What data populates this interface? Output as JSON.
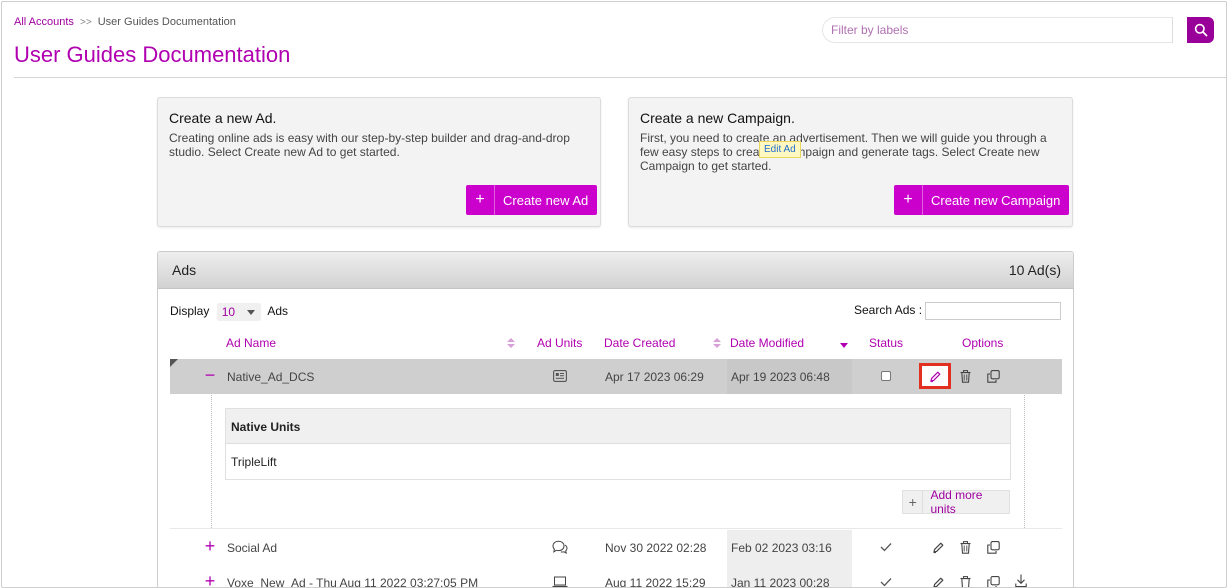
{
  "header": {
    "breadcrumb_root": "All Accounts",
    "breadcrumb_sep": ">>",
    "breadcrumb_current": "User Guides Documentation",
    "title": "User Guides Documentation",
    "filter_placeholder": "Filter by labels"
  },
  "cards": {
    "ad": {
      "title": "Create a new Ad.",
      "desc": "Creating online ads is easy with our step-by-step builder and drag-and-drop studio. Select Create new Ad to get started.",
      "button": "Create new Ad"
    },
    "campaign": {
      "title": "Create a new Campaign.",
      "desc": "First, you need to create an advertisement. Then we will guide you through a few easy steps to create a campaign and generate tags. Select Create new Campaign to get started.",
      "button": "Create new Campaign"
    },
    "plus": "+"
  },
  "ads": {
    "title": "Ads",
    "count": "10 Ad(s)",
    "display_label": "Display",
    "display_value": "10",
    "display_suffix": "Ads",
    "search_label": "Search Ads :",
    "columns": {
      "name": "Ad Name",
      "units": "Ad Units",
      "created": "Date Created",
      "modified": "Date Modified",
      "status": "Status",
      "options": "Options"
    },
    "rows": [
      {
        "expander": "−",
        "name": "Native_Ad_DCS",
        "created": "Apr 17 2023 06:29",
        "modified": "Apr 19 2023 06:48"
      },
      {
        "expander": "+",
        "name": "Social Ad",
        "created": "Nov 30 2022 02:28",
        "modified": "Feb 02 2023 03:16"
      },
      {
        "expander": "+",
        "name": "Voxe_New_Ad - Thu Aug 11 2022 03:27:05 PM",
        "created": "Aug 11 2022 15:29",
        "modified": "Jan 11 2023 00:28"
      }
    ],
    "tooltip": "Edit Ad",
    "detail": {
      "header": "Native Units",
      "unit": "TripleLift",
      "add_more": "Add more units"
    }
  },
  "colors": {
    "accent": "#cc00cc",
    "brand": "#b000b0",
    "highlight": "#e23020"
  }
}
